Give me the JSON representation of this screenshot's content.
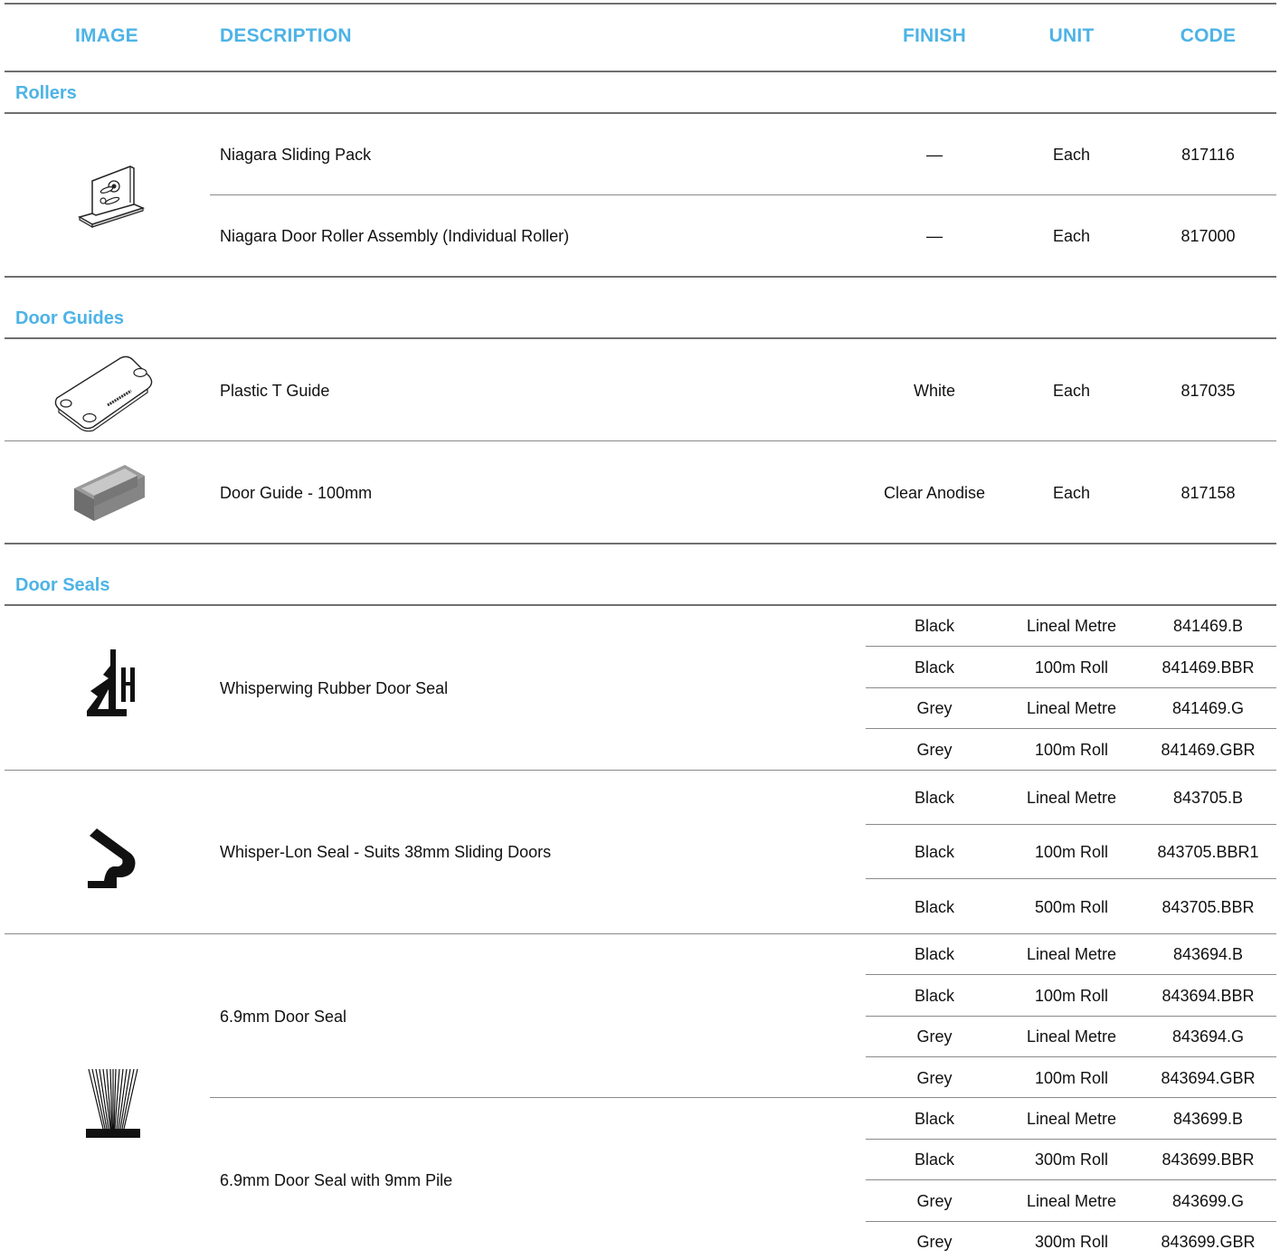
{
  "headers": {
    "image": "IMAGE",
    "description": "DESCRIPTION",
    "finish": "FINISH",
    "unit": "UNIT",
    "code": "CODE"
  },
  "sections": [
    {
      "title": "Rollers",
      "products": [
        {
          "icon": "roller-bracket-icon",
          "description": "Niagara Sliding Pack",
          "variants": [
            {
              "finish": "—",
              "unit": "Each",
              "code": "817116"
            }
          ]
        },
        {
          "description": "Niagara Door Roller Assembly (Individual Roller)",
          "variants": [
            {
              "finish": "—",
              "unit": "Each",
              "code": "817000"
            }
          ]
        }
      ]
    },
    {
      "title": "Door Guides",
      "products": [
        {
          "icon": "plastic-t-guide-icon",
          "description": "Plastic T Guide",
          "variants": [
            {
              "finish": "White",
              "unit": "Each",
              "code": "817035"
            }
          ]
        },
        {
          "icon": "door-guide-channel-icon",
          "description": "Door Guide - 100mm",
          "variants": [
            {
              "finish": "Clear Anodise",
              "unit": "Each",
              "code": "817158"
            }
          ]
        }
      ]
    },
    {
      "title": "Door Seals",
      "products": [
        {
          "icon": "whisperwing-seal-profile-icon",
          "description": "Whisperwing Rubber Door Seal",
          "variants": [
            {
              "finish": "Black",
              "unit": "Lineal Metre",
              "code": "841469.B"
            },
            {
              "finish": "Black",
              "unit": "100m Roll",
              "code": "841469.BBR"
            },
            {
              "finish": "Grey",
              "unit": "Lineal Metre",
              "code": "841469.G"
            },
            {
              "finish": "Grey",
              "unit": "100m Roll",
              "code": "841469.GBR"
            }
          ]
        },
        {
          "icon": "whisper-lon-seal-profile-icon",
          "description": "Whisper-Lon Seal - Suits 38mm Sliding Doors",
          "variants": [
            {
              "finish": "Black",
              "unit": "Lineal Metre",
              "code": "843705.B"
            },
            {
              "finish": "Black",
              "unit": "100m Roll",
              "code": "843705.BBR1"
            },
            {
              "finish": "Black",
              "unit": "500m Roll",
              "code": "843705.BBR"
            }
          ]
        },
        {
          "icon": "pile-brush-seal-icon",
          "description": "6.9mm Door Seal",
          "variants": [
            {
              "finish": "Black",
              "unit": "Lineal Metre",
              "code": "843694.B"
            },
            {
              "finish": "Black",
              "unit": "100m Roll",
              "code": "843694.BBR"
            },
            {
              "finish": "Grey",
              "unit": "Lineal Metre",
              "code": "843694.G"
            },
            {
              "finish": "Grey",
              "unit": "100m Roll",
              "code": "843694.GBR"
            }
          ]
        },
        {
          "description": "6.9mm Door Seal with 9mm Pile",
          "variants": [
            {
              "finish": "Black",
              "unit": "Lineal Metre",
              "code": "843699.B"
            },
            {
              "finish": "Black",
              "unit": "300m Roll",
              "code": "843699.BBR"
            },
            {
              "finish": "Grey",
              "unit": "Lineal Metre",
              "code": "843699.G"
            },
            {
              "finish": "Grey",
              "unit": "300m Roll",
              "code": "843699.GBR"
            }
          ]
        }
      ]
    }
  ],
  "colors": {
    "accent": "#4db3e6",
    "rule": "#6f6f6f"
  }
}
